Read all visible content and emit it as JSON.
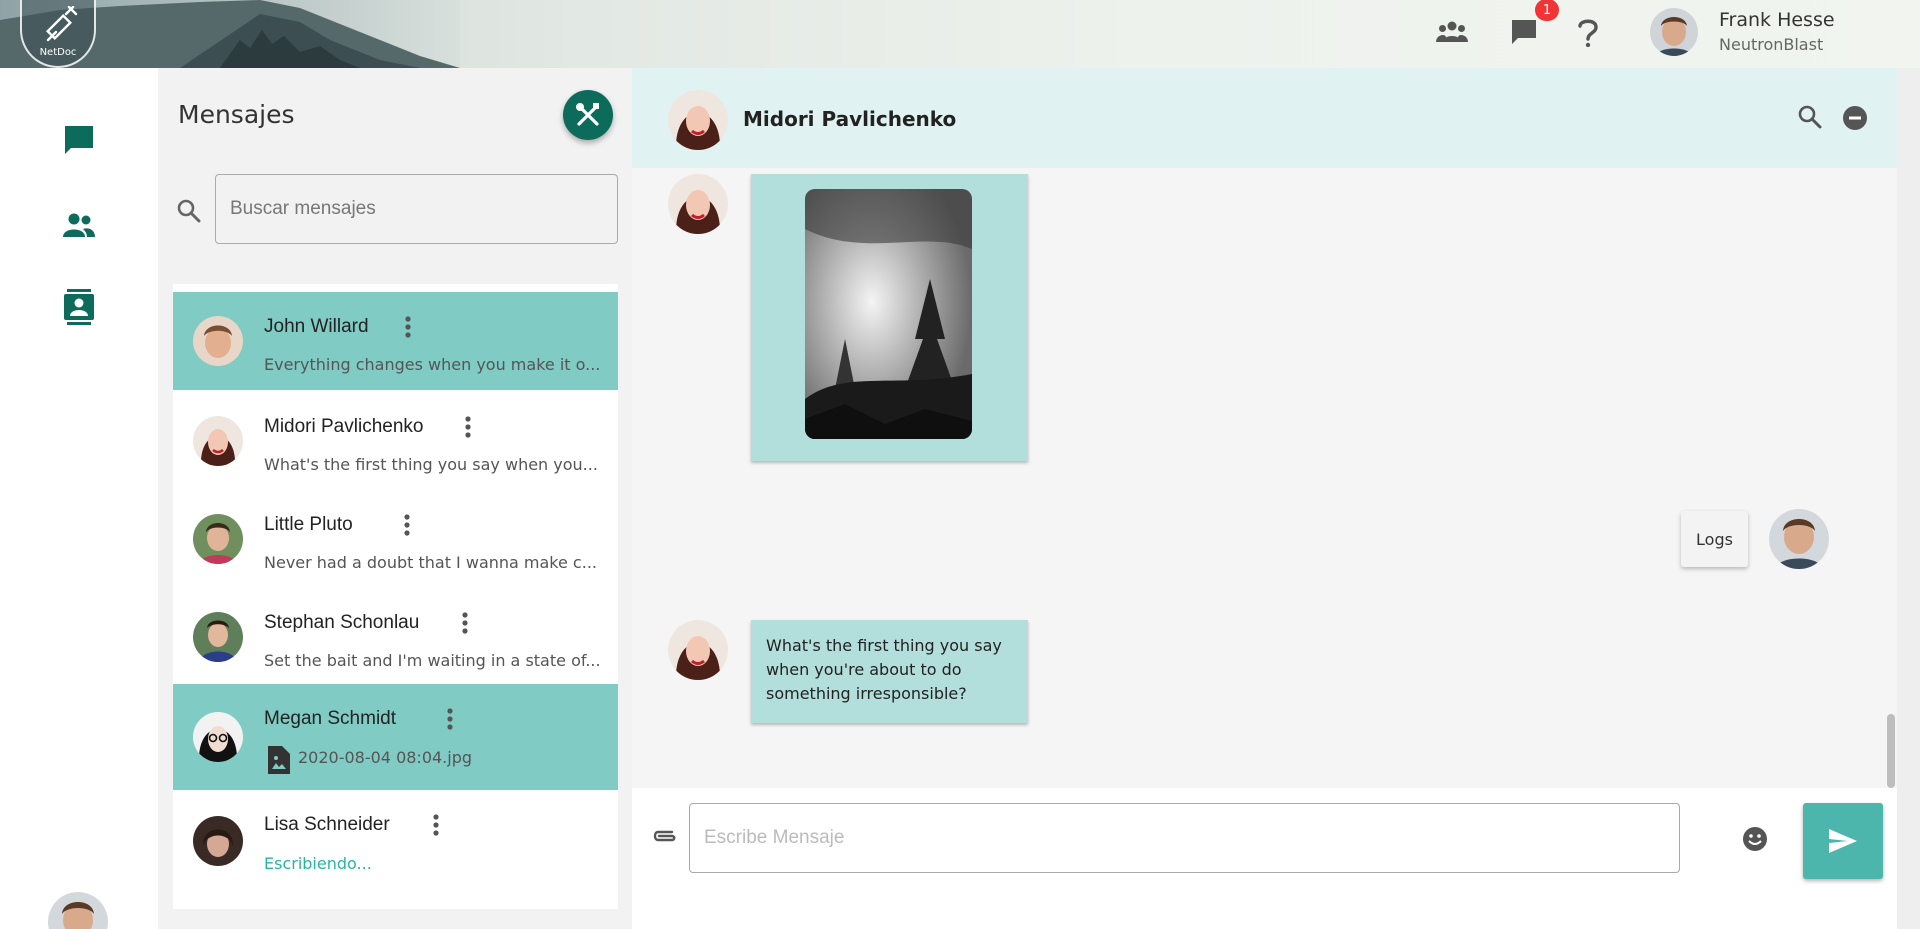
{
  "header": {
    "logo_text": "NetDoc",
    "notification_count": "1",
    "user": {
      "name": "Frank Hesse",
      "handle": "NeutronBlast"
    },
    "icons": [
      "group-icon",
      "chat-icon",
      "help-icon"
    ]
  },
  "rail": {
    "items": [
      "chat-icon",
      "people-icon",
      "contacts-icon"
    ]
  },
  "conversations": {
    "title": "Mensajes",
    "search_placeholder": "Buscar mensajes",
    "items": [
      {
        "name": "John Willard",
        "preview": "Everything changes when you make it o...",
        "active": true
      },
      {
        "name": "Midori Pavlichenko",
        "preview": "What's the first thing you say when you...",
        "active": false
      },
      {
        "name": "Little Pluto",
        "preview": "Never had a doubt that I wanna make c...",
        "active": false
      },
      {
        "name": "Stephan Schonlau",
        "preview": "Set the bait and I'm waiting in a state of...",
        "active": false
      },
      {
        "name": "Megan Schmidt",
        "preview": "2020-08-04 08:04.jpg",
        "active": true
      },
      {
        "name": "Lisa Schneider",
        "preview": "Escribiendo...",
        "active": false
      }
    ]
  },
  "chat": {
    "contact_name": "Midori Pavlichenko",
    "messages": [
      {
        "from": "contact",
        "type": "image"
      },
      {
        "from": "me",
        "type": "text",
        "text": "Logs"
      },
      {
        "from": "contact",
        "type": "text",
        "text": "What's the first thing you say when you're about to do something irresponsible?"
      }
    ],
    "compose_placeholder": "Escribe Mensaje"
  },
  "colors": {
    "primary_dark": "#0d6b5c",
    "primary": "#4db6ac",
    "active_row": "#80cbc4",
    "bubble": "#b2dfdb",
    "header_tint": "#e0f2f1",
    "badge": "#ef3535"
  }
}
